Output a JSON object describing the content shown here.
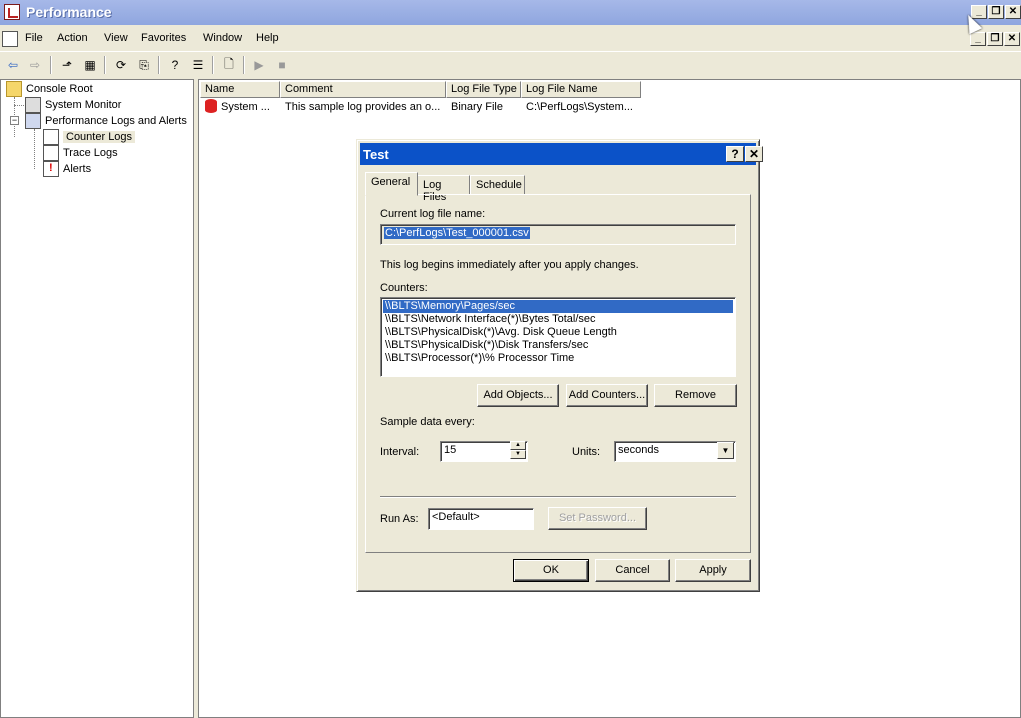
{
  "window": {
    "title": "Performance"
  },
  "menu": [
    "File",
    "Action",
    "View",
    "Favorites",
    "Window",
    "Help"
  ],
  "tree": {
    "root": "Console Root",
    "items": [
      "System Monitor",
      "Performance Logs and Alerts",
      "Counter Logs",
      "Trace Logs",
      "Alerts"
    ]
  },
  "list": {
    "columns": [
      "Name",
      "Comment",
      "Log File Type",
      "Log File Name"
    ],
    "rows": [
      {
        "name": "System ...",
        "comment": "This sample log provides an o...",
        "type": "Binary File",
        "file": "C:\\PerfLogs\\System..."
      }
    ]
  },
  "dialog": {
    "title": "Test",
    "help": "?",
    "close": "✕",
    "tabs": [
      "General",
      "Log Files",
      "Schedule"
    ],
    "current_log_label": "Current log file name:",
    "current_log_value": "C:\\PerfLogs\\Test_000001.csv",
    "info_text": "This log begins immediately after you apply changes.",
    "counters_label": "Counters:",
    "counters": [
      "\\\\BLTS\\Memory\\Pages/sec",
      "\\\\BLTS\\Network Interface(*)\\Bytes Total/sec",
      "\\\\BLTS\\PhysicalDisk(*)\\Avg. Disk Queue Length",
      "\\\\BLTS\\PhysicalDisk(*)\\Disk Transfers/sec",
      "\\\\BLTS\\Processor(*)\\% Processor Time"
    ],
    "add_objects": "Add Objects...",
    "add_counters": "Add Counters...",
    "remove": "Remove",
    "sample_label": "Sample data every:",
    "interval_label": "Interval:",
    "interval_value": "15",
    "units_label": "Units:",
    "units_value": "seconds",
    "run_as_label": "Run As:",
    "run_as_value": "<Default>",
    "set_password": "Set Password...",
    "ok": "OK",
    "cancel": "Cancel",
    "apply": "Apply"
  }
}
